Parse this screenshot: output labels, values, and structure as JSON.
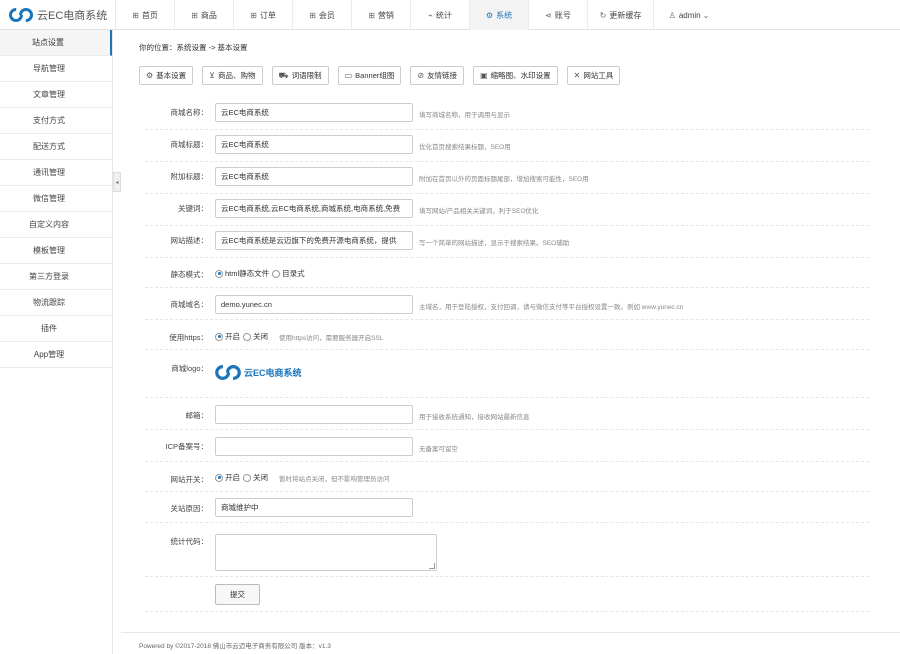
{
  "app": {
    "logo_text": "云EC电商系统"
  },
  "nav": {
    "items": [
      {
        "icon": "grid-icon",
        "label": "首页",
        "active": false
      },
      {
        "icon": "grid-icon",
        "label": "商品",
        "active": false
      },
      {
        "icon": "grid-icon",
        "label": "订单",
        "active": false
      },
      {
        "icon": "grid-icon",
        "label": "会员",
        "active": false
      },
      {
        "icon": "grid-icon",
        "label": "营销",
        "active": false
      },
      {
        "icon": "pulse-icon",
        "label": "统计",
        "active": false
      },
      {
        "icon": "gear-icon",
        "label": "系统",
        "active": true
      },
      {
        "icon": "share-icon",
        "label": "账号",
        "active": false
      },
      {
        "icon": "refresh-icon",
        "label": "更新缓存",
        "active": false
      }
    ],
    "user": {
      "icon": "user-icon",
      "label": "admin",
      "caret": "⌄"
    }
  },
  "sidebar": {
    "items": [
      {
        "label": "站点设置",
        "active": true
      },
      {
        "label": "导航管理"
      },
      {
        "label": "文章管理"
      },
      {
        "label": "支付方式"
      },
      {
        "label": "配送方式"
      },
      {
        "label": "通讯管理"
      },
      {
        "label": "微信管理"
      },
      {
        "label": "自定义内容"
      },
      {
        "label": "模板管理"
      },
      {
        "label": "第三方登录"
      },
      {
        "label": "物流跟踪"
      },
      {
        "label": "插件"
      },
      {
        "label": "App管理"
      }
    ],
    "collapse_glyph": "◂"
  },
  "breadcrumb": {
    "prefix": "你的位置：",
    "path": "系统设置 -> 基本设置"
  },
  "tabs": [
    {
      "icon": "gear-icon",
      "label": "基本设置"
    },
    {
      "icon": "cart-icon",
      "label": "商品、购物"
    },
    {
      "icon": "truck-icon",
      "label": "词语限制"
    },
    {
      "icon": "image-icon",
      "label": "Banner组图"
    },
    {
      "icon": "link-icon",
      "label": "友情链接"
    },
    {
      "icon": "thumbnail-icon",
      "label": "缩略图、水印设置"
    },
    {
      "icon": "tools-icon",
      "label": "网站工具"
    }
  ],
  "form": {
    "shop_name": {
      "label": "商城名称：",
      "value": "云EC电商系统",
      "hint": "填写商城名称，用于调用与显示"
    },
    "shop_title": {
      "label": "商城标题：",
      "value": "云EC电商系统",
      "hint": "优化首页搜索结果标题，SEO用"
    },
    "extra_title": {
      "label": "附加标题：",
      "value": "云EC电商系统",
      "hint": "附加在首页以外的页面标题尾部，增加搜索可能性，SEO用"
    },
    "keywords": {
      "label": "关键词：",
      "value": "云EC电商系统,云EC电商系统,商城系统,电商系统,免费",
      "hint": "填写网站/产品相关关键词，利于SEO优化"
    },
    "description": {
      "label": "网站描述：",
      "value": "云EC电商系统是云迈旗下的免费开源电商系统，提供",
      "hint": "写一个简单的网站描述，显示于搜索结果。SEO辅助"
    },
    "static_mode": {
      "label": "静态模式：",
      "options": [
        "html静态文件",
        "目录式"
      ],
      "selected": 0
    },
    "domain": {
      "label": "商城域名：",
      "value": "demo.yunec.cn",
      "hint": "主域名，用于登陆授权，支付回调，请与微信支付等平台授权设置一致。例如 www.yunec.cn"
    },
    "https": {
      "label": "使用https：",
      "options": [
        "开启",
        "关闭"
      ],
      "selected": 0,
      "hint": "使用https访问，需要服务器开启SSL"
    },
    "logo": {
      "label": "商城logo：",
      "text": "云EC电商系统"
    },
    "email": {
      "label": "邮箱：",
      "value": "",
      "hint": "用于接收系统通知，接收网站最新信息"
    },
    "icp": {
      "label": "ICP备案号：",
      "value": "",
      "hint": "无备案可留空"
    },
    "site_switch": {
      "label": "网站开关：",
      "options": [
        "开启",
        "关闭"
      ],
      "selected": 0,
      "hint": "暂时将站点关闭，但不影响管理员访问"
    },
    "close_reason": {
      "label": "关站原因：",
      "value": "商城维护中"
    },
    "stat_code": {
      "label": "统计代码：",
      "value": ""
    },
    "submit_label": "提交"
  },
  "footer": {
    "text": "Powered by ©2017-2018 佛山市云迈电子商务有限公司 版本：v1.3"
  },
  "colors": {
    "accent": "#1b75bb"
  }
}
